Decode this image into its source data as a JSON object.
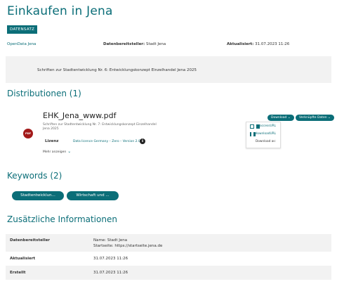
{
  "page": {
    "title": "Einkaufen in Jena",
    "tag": "DATENSATZ"
  },
  "meta": {
    "source_link": "OpenData Jena",
    "provider_label": "Datenbereitsteller:",
    "provider_value": "Stadt Jena",
    "updated_label": "Aktualisiert:",
    "updated_value": "31.07.2023 11:26"
  },
  "description": "Schriften zur Stadtentwicklung Nr. 6: Entwicklungskonzept Einzelhandel Jena 2025",
  "distributions": {
    "heading": "Distributionen (1)",
    "item": {
      "icon_text": "PDF",
      "file_name": "EHK_Jena_www.pdf",
      "subtitle": "Schriften zur Stadtentwicklung Nr. 7: Entwicklungskonzept Einzelhandel Jena 2025",
      "license_label": "Lizenz",
      "license_value": "Data licence Germany – Zero – Version 2.0",
      "more_label": "Mehr anzeigen",
      "download_button": "Download",
      "linked_button": "Verknüpfte Daten",
      "dropdown": {
        "access_url": "accessURL",
        "download_url": "downloadURL",
        "download_as": "Download as:"
      }
    }
  },
  "keywords": {
    "heading": "Keywords (2)",
    "items": [
      "Stadtentwicklun...",
      "Wirtschaft und ..."
    ]
  },
  "additional": {
    "heading": "Zusätzliche Informationen",
    "rows": [
      {
        "key": "Datenbereitsteller",
        "line1": "Name: Stadt Jena",
        "line2": "Startseite: https://startseite.jena.de"
      },
      {
        "key": "Aktualisiert",
        "line1": "31.07.2023 11:26",
        "line2": ""
      },
      {
        "key": "Erstellt",
        "line1": "31.07.2023 11:26",
        "line2": ""
      }
    ]
  },
  "colors": {
    "accent": "#0b6e78",
    "pdf_badge": "#a31a1a",
    "panel_bg": "#f2f2f2"
  }
}
